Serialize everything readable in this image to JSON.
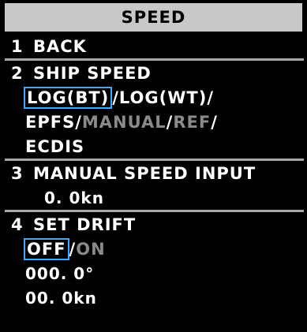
{
  "title": "SPEED",
  "menu": {
    "item1": {
      "number": "1",
      "label": "BACK"
    },
    "item2": {
      "number": "2",
      "label": "SHIP SPEED",
      "options_line1": [
        "LOG(BT)",
        "/",
        "LOG(WT)",
        "/"
      ],
      "options_line2": [
        "EPFS",
        "/",
        "MANUAL",
        "/",
        "REF",
        "/"
      ],
      "options_line3": [
        "ECDIS"
      ]
    },
    "item3": {
      "number": "3",
      "label": "MANUAL SPEED INPUT",
      "value": "0. 0kn"
    },
    "item4": {
      "number": "4",
      "label": "SET DRIFT",
      "toggle": [
        "OFF",
        "/",
        "ON"
      ],
      "angle": "000. 0°",
      "speed": "00. 0kn"
    }
  },
  "colors": {
    "background": "#000000",
    "title_bg": "#c8c8c8",
    "text": "#ffffff",
    "dim_text": "#8a8a8a",
    "selection": "#3fa7ff",
    "divider": "#a8a8a8"
  }
}
